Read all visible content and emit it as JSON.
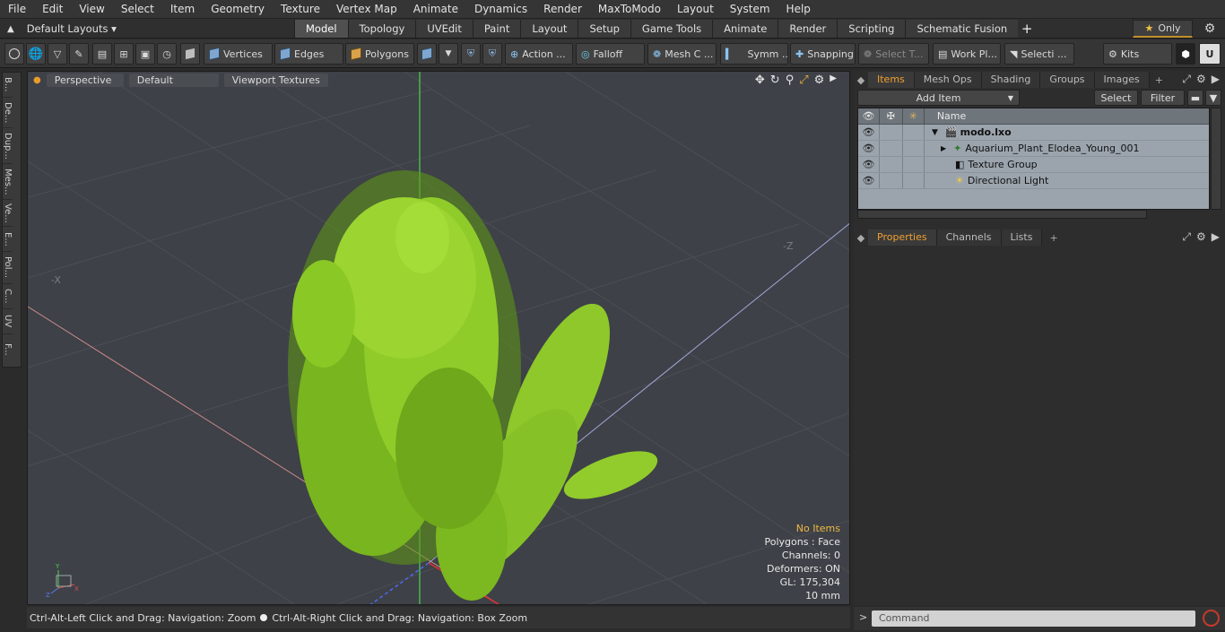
{
  "menu": [
    "File",
    "Edit",
    "View",
    "Select",
    "Item",
    "Geometry",
    "Texture",
    "Vertex Map",
    "Animate",
    "Dynamics",
    "Render",
    "MaxToModo",
    "Layout",
    "System",
    "Help"
  ],
  "layout_selector": "Default Layouts ▾",
  "mode_tabs": [
    "Model",
    "Topology",
    "UVEdit",
    "Paint",
    "Layout",
    "Setup",
    "Game Tools",
    "Animate",
    "Render",
    "Scripting",
    "Schematic Fusion"
  ],
  "active_tab": "Model",
  "only_label": "Only",
  "toolbar": {
    "vertices": "Vertices",
    "edges": "Edges",
    "polygons": "Polygons",
    "action": "Action ...",
    "falloff": "Falloff",
    "mesh_c": "Mesh C ...",
    "symm": "Symm ...",
    "snapping": "Snapping",
    "select_t": "Select T...",
    "work_pl": "Work Pl...",
    "selecti": "Selecti ...",
    "kits": "Kits"
  },
  "left_tabs": [
    "B...",
    "De...",
    "Dup...",
    "Mes...",
    "Ve...",
    "E...",
    "Pol...",
    "C...",
    "UV",
    "F..."
  ],
  "viewport": {
    "view_mode": "Perspective",
    "shading": "Default",
    "textures": "Viewport Textures",
    "axis_labels": [
      "-X",
      "-Z"
    ]
  },
  "hud": {
    "items": "No Items",
    "polygons": "Polygons : Face",
    "channels": "Channels: 0",
    "deformers": "Deformers: ON",
    "gl": "GL: 175,304",
    "scale": "10 mm"
  },
  "status_left": "Ctrl-Alt-Left Click and Drag: Navigation: Zoom",
  "status_right": "Ctrl-Alt-Right Click and Drag: Navigation: Box Zoom",
  "items_tabs": [
    "Items",
    "Mesh Ops",
    "Shading",
    "Groups",
    "Images"
  ],
  "items_panel": {
    "add_item": "Add Item",
    "select": "Select",
    "filter": "Filter",
    "column_name": "Name",
    "rows": [
      {
        "label": "modo.lxo",
        "indent": 0
      },
      {
        "label": "Aquarium_Plant_Elodea_Young_001",
        "indent": 1
      },
      {
        "label": "Texture Group",
        "indent": 1
      },
      {
        "label": "Directional Light",
        "indent": 1
      }
    ]
  },
  "props_tabs": [
    "Properties",
    "Channels",
    "Lists"
  ],
  "command_placeholder": "Command",
  "colors": {
    "accent": "#f0a030",
    "plant": "#8fcc2a"
  }
}
